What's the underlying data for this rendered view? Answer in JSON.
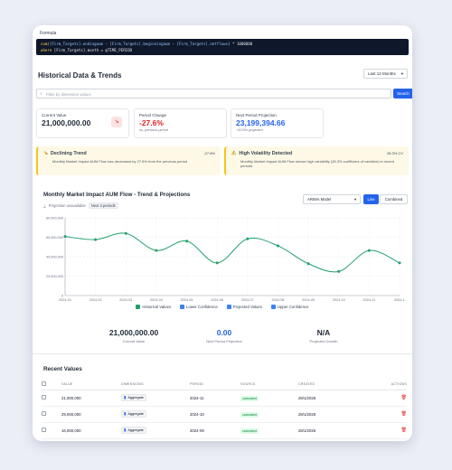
{
  "formula": {
    "label": "Formula",
    "line1_a": "sum(",
    "line1_b": "[Firm_Targets].endingaum",
    "line1_c": " - ",
    "line1_d": "[Firm_Targets].beginningaum",
    "line1_e": " - ",
    "line1_f": "[Firm_Targets].netflows",
    "line1_g": ") * 1000000",
    "line2_a": "where ",
    "line2_b": "[Firm_Targets].month = @TIME_PERIOD"
  },
  "header": {
    "title": "Historical Data & Trends",
    "period": "Last 12 Months"
  },
  "search": {
    "placeholder": "Filter by dimension values",
    "button": "Search"
  },
  "stats": {
    "current": {
      "label": "Current Value",
      "value": "21,000,000.00"
    },
    "change": {
      "label": "Period Change",
      "value": "-27.6%",
      "sub": "vs. previous period"
    },
    "projection": {
      "label": "Next Period Projection",
      "value": "23,199,394.66",
      "sub": "+10.5% projected"
    }
  },
  "alerts": {
    "declining": {
      "title": "Declining Trend",
      "pct": "-27.6%",
      "message": "Monthly Market Impact AUM Flow has decreased by 27.6% from the previous period"
    },
    "volatility": {
      "title": "High Volatility Detected",
      "pct": "28.3% CV",
      "message": "Monthly Market Impact AUM Flow shows high variability (28.3% coefficient of variation) in recent periods."
    }
  },
  "chart_panel": {
    "title": "Monthly Market Impact AUM Flow - Trend & Projections",
    "projection_status": "Projection unavailable",
    "badge": "Next 3 periods",
    "model": "ARIMA Model",
    "view_line": "Line",
    "view_combined": "Combined"
  },
  "chart_data": {
    "type": "line",
    "x": [
      "2024-01",
      "2024-02",
      "2024-03",
      "2024-04",
      "2024-05",
      "2024-06",
      "2024-07",
      "2024-08",
      "2024-09",
      "2024-10",
      "2024-11",
      "2024-12"
    ],
    "tick_labels_x": [
      "2024-01",
      "2024-02",
      "2024-03",
      "2024-04",
      "2024-05",
      "2024-06",
      "2024-07",
      "2024-08",
      "2024-09",
      "2024-10",
      "2024-11",
      "2024-1"
    ],
    "series": [
      {
        "name": "Historical Values",
        "color": "#22a06b",
        "values": [
          38000000,
          36000000,
          40000000,
          29000000,
          35000000,
          21000000,
          36500000,
          32000000,
          20500000,
          15500000,
          29000000,
          21000000
        ]
      }
    ],
    "ylim": [
      0,
      50000000
    ],
    "y_ticks": [
      0,
      20000000,
      40000000,
      60000000,
      80000000
    ],
    "y_tick_labels": [
      "0",
      "20,000,000",
      "40,000,000",
      "60,000,000",
      "80,000,000"
    ],
    "y_tick_labels_shown": [
      "0",
      "20,000,000",
      "40,000,000",
      "60,000,000",
      "80,000,000"
    ],
    "grid": true
  },
  "legend": [
    {
      "label": "Historical Values",
      "color": "#22a06b"
    },
    {
      "label": "Lower Confidence",
      "color": "#3b82f6"
    },
    {
      "label": "Projected Values",
      "color": "#3b82f6"
    },
    {
      "label": "Upper Confidence",
      "color": "#3b82f6"
    }
  ],
  "summary": {
    "current": {
      "value": "21,000,000.00",
      "label": "Current Value",
      "color": "#111827"
    },
    "projection": {
      "value": "0.00",
      "label": "Next Period Projection",
      "color": "#2563eb"
    },
    "growth": {
      "value": "N/A",
      "label": "Projected Growth",
      "color": "#111827"
    }
  },
  "recent": {
    "title": "Recent Values",
    "columns": [
      "VALUE",
      "DIMENSIONS",
      "PERIOD",
      "SOURCE",
      "CREATED",
      "ACTIONS"
    ],
    "rows": [
      {
        "value": "21,000,000",
        "dimension": "Aggregate",
        "period": "2024-11",
        "source": "calculated",
        "created": "28/1/2026"
      },
      {
        "value": "29,000,000",
        "dimension": "Aggregate",
        "period": "2024-10",
        "source": "calculated",
        "created": "28/1/2026"
      },
      {
        "value": "16,000,000",
        "dimension": "Aggregate",
        "period": "2024-09",
        "source": "calculated",
        "created": "28/1/2026"
      }
    ]
  }
}
